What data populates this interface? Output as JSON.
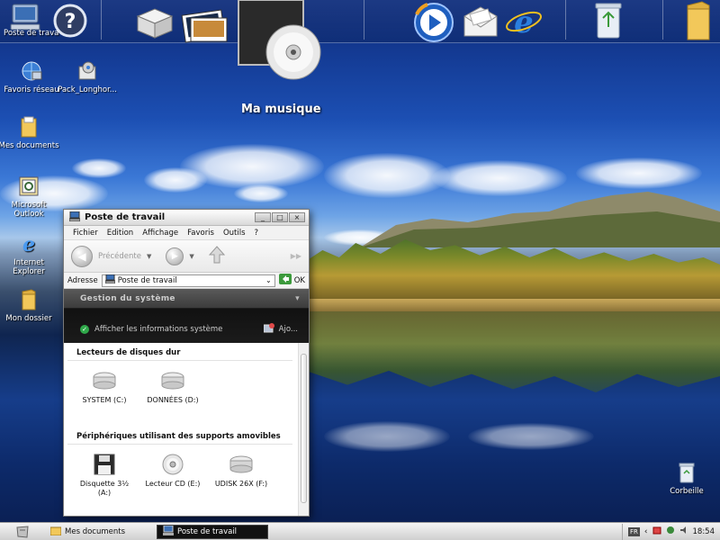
{
  "dock": {
    "left_truncated_label": "Poste de trava",
    "featured_label": "Ma musique"
  },
  "desktop_icons": [
    {
      "label": "Favoris réseau",
      "icon": "network-favorites-icon"
    },
    {
      "label": "Pack_Longhor...",
      "icon": "package-icon"
    },
    {
      "label": "Mes documents",
      "icon": "folder-icon"
    },
    {
      "label": "Microsoft Outlook",
      "icon": "outlook-icon"
    },
    {
      "label": "Internet Explorer",
      "icon": "internet-explorer-icon"
    },
    {
      "label": "Mon dossier",
      "icon": "folder-icon"
    },
    {
      "label": "Corbeille",
      "icon": "recycle-bin-icon"
    }
  ],
  "window": {
    "title": "Poste de travail",
    "controls": {
      "minimize": "_",
      "maximize": "□",
      "close": "×"
    },
    "menu": [
      "Fichier",
      "Edition",
      "Affichage",
      "Favoris",
      "Outils",
      "?"
    ],
    "toolbar": {
      "back_label": "Précédente",
      "forward_arrow": "▶"
    },
    "address": {
      "label": "Adresse",
      "value": "Poste de travail",
      "go_label": "OK"
    },
    "tasks": {
      "header": "Gestion du système",
      "item1": "Afficher les informations système",
      "item2": "Ajo..."
    },
    "sections": [
      {
        "title": "Lecteurs de disques dur",
        "items": [
          {
            "label": "SYSTEM (C:)",
            "icon": "hard-drive-icon"
          },
          {
            "label": "DONNÉES (D:)",
            "icon": "hard-drive-icon"
          }
        ]
      },
      {
        "title": "Périphériques utilisant des supports amovibles",
        "items": [
          {
            "label": "Disquette 3½ (A:)",
            "icon": "floppy-icon"
          },
          {
            "label": "Lecteur CD (E:)",
            "icon": "cd-drive-icon"
          },
          {
            "label": "UDISK 26X (F:)",
            "icon": "usb-drive-icon"
          }
        ]
      }
    ]
  },
  "taskbar": {
    "items": [
      {
        "label": "Mes documents",
        "active": false
      },
      {
        "label": "Poste de travail",
        "active": true
      }
    ],
    "language": "FR",
    "clock": "18:54"
  }
}
